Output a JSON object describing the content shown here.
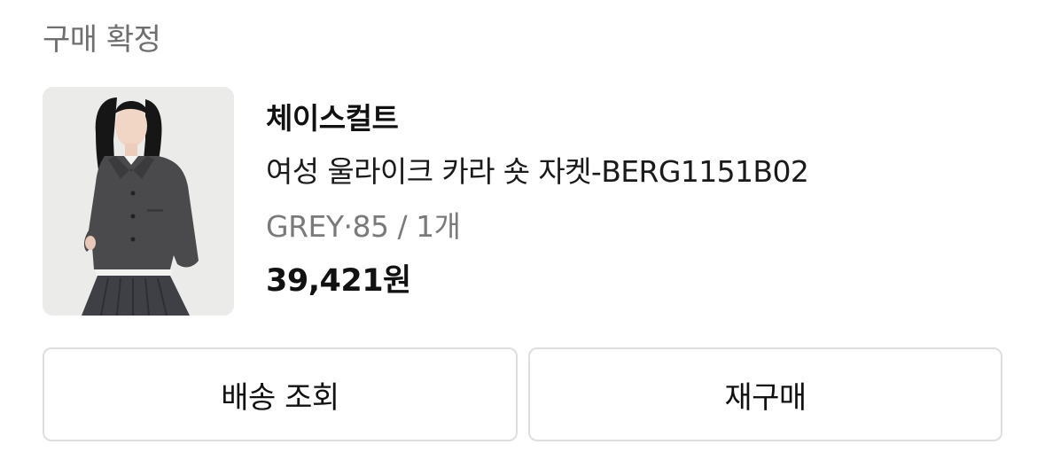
{
  "order": {
    "status": "구매 확정"
  },
  "product": {
    "brand": "체이스컬트",
    "name": "여성 울라이크 카라 숏 자켓-BERG1151B02",
    "option": "GREY·85 / 1개",
    "price": "39,421원"
  },
  "actions": {
    "track_label": "배송 조회",
    "rebuy_label": "재구매"
  },
  "colors": {
    "status_text": "#6f6f6f",
    "option_text": "#7a7a7a",
    "button_border": "#dedede"
  }
}
